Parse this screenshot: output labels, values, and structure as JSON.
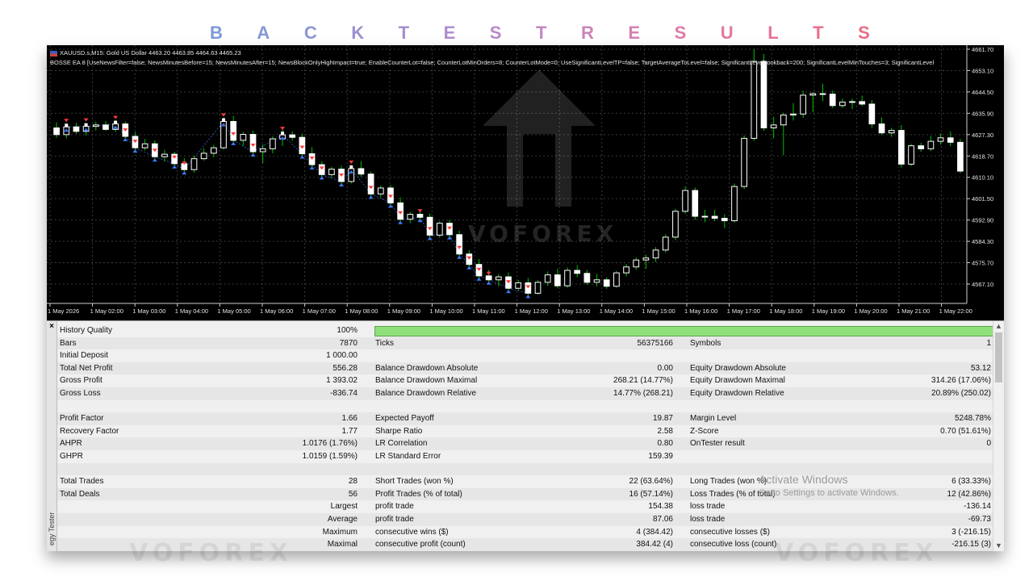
{
  "page_title": {
    "letters": [
      {
        "ch": "B",
        "color": "#7b9ad8"
      },
      {
        "ch": "A",
        "color": "#8597d6"
      },
      {
        "ch": "C",
        "color": "#8f95d4"
      },
      {
        "ch": "K",
        "color": "#9a92d2"
      },
      {
        "ch": "T",
        "color": "#a590cf"
      },
      {
        "ch": "E",
        "color": "#b08ecc"
      },
      {
        "ch": "S",
        "color": "#ba8ac8"
      },
      {
        "ch": "T",
        "color": "#c487c2"
      },
      {
        "ch": "R",
        "color": "#cc84ba"
      },
      {
        "ch": "E",
        "color": "#d680b2"
      },
      {
        "ch": "S",
        "color": "#dd7ca9"
      },
      {
        "ch": "U",
        "color": "#e278a0"
      },
      {
        "ch": "L",
        "color": "#e57496"
      },
      {
        "ch": "T",
        "color": "#e8718d"
      },
      {
        "ch": "S",
        "color": "#ea6d85"
      }
    ]
  },
  "chart": {
    "symbol_line": "XAUUSD.s,M15:  Gold US Dollar  4463.20 4463.85 4464.63 4465.23",
    "ea_line": "BOSSE EA 8 [UseNewsFilter=false; NewsMinutesBefore=15; NewsMinutesAfter=15; NewsBlockOnlyHighImpact=true; EnableCounterLot=false; CounterLotMinOrders=8; CounterLotMode=0; UseSignificantLevelTP=false; TargetAverageToLevel=false; SignificantLevelLookback=200; SignificantLevelMinTouches=3; SignificantLevel",
    "watermark": "VOFOREX",
    "price_labels": [
      "4661.70",
      "4653.10",
      "4644.50",
      "4635.90",
      "4627.30",
      "4618.70",
      "4610.10",
      "4601.50",
      "4592.90",
      "4584.30",
      "4575.70",
      "4567.10"
    ],
    "time_labels": [
      "1 May 2026",
      "1 May 02:00",
      "1 May 03:00",
      "1 May 04:00",
      "1 May 05:00",
      "1 May 06:00",
      "1 May 07:00",
      "1 May 08:00",
      "1 May 09:00",
      "1 May 10:00",
      "1 May 11:00",
      "1 May 12:00",
      "1 May 13:00",
      "1 May 14:00",
      "1 May 15:00",
      "1 May 16:00",
      "1 May 17:00",
      "1 May 18:00",
      "1 May 19:00",
      "1 May 20:00",
      "1 May 21:00",
      "1 May 22:00"
    ],
    "colors": {
      "background": "#000000",
      "bull": "#ffffff",
      "bear": "#ffffff",
      "wick": "#00c000",
      "grid": "#3a3a3a",
      "buy_marker": "#3a7bff",
      "sell_marker": "#ff3b3b",
      "order_line": "#3a6fd8"
    },
    "candles": [
      {
        "o": 4630.0,
        "h": 4632.2,
        "l": 4626.0,
        "c": 4627.3
      },
      {
        "o": 4627.3,
        "h": 4631.2,
        "l": 4625.8,
        "c": 4630.4
      },
      {
        "o": 4630.4,
        "h": 4632.0,
        "l": 4627.6,
        "c": 4628.6
      },
      {
        "o": 4628.6,
        "h": 4631.8,
        "l": 4627.0,
        "c": 4630.6
      },
      {
        "o": 4630.6,
        "h": 4632.5,
        "l": 4628.9,
        "c": 4631.2
      },
      {
        "o": 4631.2,
        "h": 4632.8,
        "l": 4628.8,
        "c": 4629.4
      },
      {
        "o": 4629.4,
        "h": 4633.0,
        "l": 4628.4,
        "c": 4631.6
      },
      {
        "o": 4631.6,
        "h": 4632.6,
        "l": 4625.8,
        "c": 4626.6
      },
      {
        "o": 4626.6,
        "h": 4628.4,
        "l": 4620.8,
        "c": 4622.0
      },
      {
        "o": 4622.0,
        "h": 4625.6,
        "l": 4620.9,
        "c": 4623.6
      },
      {
        "o": 4623.6,
        "h": 4625.0,
        "l": 4617.6,
        "c": 4618.4
      },
      {
        "o": 4618.4,
        "h": 4621.2,
        "l": 4616.4,
        "c": 4619.4
      },
      {
        "o": 4619.4,
        "h": 4620.4,
        "l": 4614.8,
        "c": 4615.6
      },
      {
        "o": 4615.6,
        "h": 4617.8,
        "l": 4612.2,
        "c": 4613.2
      },
      {
        "o": 4613.2,
        "h": 4618.8,
        "l": 4612.0,
        "c": 4617.6
      },
      {
        "o": 4617.6,
        "h": 4621.8,
        "l": 4616.8,
        "c": 4619.8
      },
      {
        "o": 4619.8,
        "h": 4623.2,
        "l": 4618.2,
        "c": 4622.0
      },
      {
        "o": 4622.0,
        "h": 4634.0,
        "l": 4621.2,
        "c": 4632.6
      },
      {
        "o": 4632.6,
        "h": 4634.8,
        "l": 4624.0,
        "c": 4625.0
      },
      {
        "o": 4625.0,
        "h": 4628.4,
        "l": 4622.8,
        "c": 4627.4
      },
      {
        "o": 4627.4,
        "h": 4628.9,
        "l": 4619.4,
        "c": 4620.4
      },
      {
        "o": 4620.4,
        "h": 4623.4,
        "l": 4615.8,
        "c": 4621.6
      },
      {
        "o": 4621.6,
        "h": 4626.6,
        "l": 4619.8,
        "c": 4625.6
      },
      {
        "o": 4625.6,
        "h": 4629.6,
        "l": 4622.8,
        "c": 4627.2
      },
      {
        "o": 4627.2,
        "h": 4628.6,
        "l": 4624.8,
        "c": 4626.2
      },
      {
        "o": 4626.2,
        "h": 4627.6,
        "l": 4618.8,
        "c": 4619.6
      },
      {
        "o": 4619.6,
        "h": 4622.2,
        "l": 4613.8,
        "c": 4615.2
      },
      {
        "o": 4615.2,
        "h": 4616.6,
        "l": 4609.8,
        "c": 4611.2
      },
      {
        "o": 4611.2,
        "h": 4614.4,
        "l": 4610.1,
        "c": 4613.4
      },
      {
        "o": 4613.4,
        "h": 4614.8,
        "l": 4607.6,
        "c": 4608.4
      },
      {
        "o": 4608.4,
        "h": 4614.8,
        "l": 4607.6,
        "c": 4613.6
      },
      {
        "o": 4613.6,
        "h": 4616.6,
        "l": 4610.2,
        "c": 4611.4
      },
      {
        "o": 4611.4,
        "h": 4612.4,
        "l": 4602.0,
        "c": 4603.4
      },
      {
        "o": 4603.4,
        "h": 4606.8,
        "l": 4602.0,
        "c": 4605.8
      },
      {
        "o": 4605.8,
        "h": 4607.0,
        "l": 4598.6,
        "c": 4599.8
      },
      {
        "o": 4599.8,
        "h": 4602.0,
        "l": 4592.0,
        "c": 4593.2
      },
      {
        "o": 4593.2,
        "h": 4596.2,
        "l": 4591.6,
        "c": 4595.2
      },
      {
        "o": 4595.2,
        "h": 4596.8,
        "l": 4592.8,
        "c": 4594.0
      },
      {
        "o": 4594.0,
        "h": 4595.4,
        "l": 4585.6,
        "c": 4586.8
      },
      {
        "o": 4586.8,
        "h": 4592.4,
        "l": 4585.8,
        "c": 4591.6
      },
      {
        "o": 4591.6,
        "h": 4593.0,
        "l": 4586.0,
        "c": 4587.0
      },
      {
        "o": 4587.0,
        "h": 4588.6,
        "l": 4578.0,
        "c": 4579.2
      },
      {
        "o": 4579.2,
        "h": 4580.8,
        "l": 4573.8,
        "c": 4575.0
      },
      {
        "o": 4575.0,
        "h": 4577.2,
        "l": 4569.4,
        "c": 4570.4
      },
      {
        "o": 4570.4,
        "h": 4572.8,
        "l": 4568.0,
        "c": 4568.8
      },
      {
        "o": 4568.8,
        "h": 4571.2,
        "l": 4566.2,
        "c": 4570.0
      },
      {
        "o": 4570.0,
        "h": 4571.8,
        "l": 4564.4,
        "c": 4565.4
      },
      {
        "o": 4565.4,
        "h": 4568.8,
        "l": 4564.4,
        "c": 4567.6
      },
      {
        "o": 4567.6,
        "h": 4569.6,
        "l": 4562.4,
        "c": 4563.4
      },
      {
        "o": 4563.4,
        "h": 4568.6,
        "l": 4562.8,
        "c": 4567.8
      },
      {
        "o": 4567.8,
        "h": 4572.2,
        "l": 4566.4,
        "c": 4570.8
      },
      {
        "o": 4570.8,
        "h": 4573.2,
        "l": 4565.4,
        "c": 4566.4
      },
      {
        "o": 4566.4,
        "h": 4573.8,
        "l": 4565.6,
        "c": 4572.6
      },
      {
        "o": 4572.6,
        "h": 4574.8,
        "l": 4569.8,
        "c": 4571.4
      },
      {
        "o": 4571.4,
        "h": 4572.8,
        "l": 4566.8,
        "c": 4567.8
      },
      {
        "o": 4567.8,
        "h": 4571.2,
        "l": 4566.2,
        "c": 4568.8
      },
      {
        "o": 4568.8,
        "h": 4569.8,
        "l": 4565.2,
        "c": 4566.2
      },
      {
        "o": 4566.2,
        "h": 4572.4,
        "l": 4565.6,
        "c": 4571.6
      },
      {
        "o": 4571.6,
        "h": 4575.2,
        "l": 4570.2,
        "c": 4574.0
      },
      {
        "o": 4574.0,
        "h": 4577.8,
        "l": 4572.8,
        "c": 4576.8
      },
      {
        "o": 4576.8,
        "h": 4579.0,
        "l": 4573.2,
        "c": 4577.6
      },
      {
        "o": 4577.6,
        "h": 4582.0,
        "l": 4576.0,
        "c": 4580.8
      },
      {
        "o": 4580.8,
        "h": 4587.2,
        "l": 4579.8,
        "c": 4586.0
      },
      {
        "o": 4586.0,
        "h": 4597.4,
        "l": 4584.8,
        "c": 4596.4
      },
      {
        "o": 4596.4,
        "h": 4606.4,
        "l": 4595.4,
        "c": 4604.8
      },
      {
        "o": 4604.8,
        "h": 4606.0,
        "l": 4593.0,
        "c": 4594.4
      },
      {
        "o": 4594.4,
        "h": 4597.0,
        "l": 4592.0,
        "c": 4594.4
      },
      {
        "o": 4594.4,
        "h": 4597.0,
        "l": 4592.4,
        "c": 4593.6
      },
      {
        "o": 4593.6,
        "h": 4595.2,
        "l": 4589.6,
        "c": 4592.6
      },
      {
        "o": 4592.6,
        "h": 4607.6,
        "l": 4591.8,
        "c": 4606.4
      },
      {
        "o": 4606.4,
        "h": 4627.0,
        "l": 4605.4,
        "c": 4625.8
      },
      {
        "o": 4625.8,
        "h": 4661.8,
        "l": 4624.8,
        "c": 4656.8
      },
      {
        "o": 4656.8,
        "h": 4659.8,
        "l": 4628.8,
        "c": 4630.0
      },
      {
        "o": 4630.0,
        "h": 4634.4,
        "l": 4625.8,
        "c": 4631.2
      },
      {
        "o": 4631.2,
        "h": 4636.2,
        "l": 4619.0,
        "c": 4635.2
      },
      {
        "o": 4635.2,
        "h": 4640.0,
        "l": 4633.0,
        "c": 4635.6
      },
      {
        "o": 4635.6,
        "h": 4645.0,
        "l": 4634.0,
        "c": 4643.2
      },
      {
        "o": 4643.2,
        "h": 4644.4,
        "l": 4636.2,
        "c": 4643.8
      },
      {
        "o": 4643.8,
        "h": 4647.8,
        "l": 4640.8,
        "c": 4643.6
      },
      {
        "o": 4643.6,
        "h": 4645.0,
        "l": 4638.0,
        "c": 4639.0
      },
      {
        "o": 4639.0,
        "h": 4641.8,
        "l": 4638.0,
        "c": 4640.4
      },
      {
        "o": 4640.4,
        "h": 4641.8,
        "l": 4637.6,
        "c": 4640.6
      },
      {
        "o": 4640.6,
        "h": 4643.0,
        "l": 4638.8,
        "c": 4639.6
      },
      {
        "o": 4639.6,
        "h": 4641.2,
        "l": 4630.0,
        "c": 4631.6
      },
      {
        "o": 4631.6,
        "h": 4634.2,
        "l": 4627.2,
        "c": 4628.0
      },
      {
        "o": 4628.0,
        "h": 4630.0,
        "l": 4626.4,
        "c": 4629.0
      },
      {
        "o": 4629.0,
        "h": 4631.2,
        "l": 4614.0,
        "c": 4615.4
      },
      {
        "o": 4615.4,
        "h": 4623.6,
        "l": 4614.6,
        "c": 4622.8
      },
      {
        "o": 4622.8,
        "h": 4624.0,
        "l": 4620.4,
        "c": 4621.6
      },
      {
        "o": 4621.6,
        "h": 4626.8,
        "l": 4620.6,
        "c": 4624.6
      },
      {
        "o": 4624.6,
        "h": 4627.8,
        "l": 4623.2,
        "c": 4626.0
      },
      {
        "o": 4626.0,
        "h": 4628.6,
        "l": 4622.6,
        "c": 4624.2
      },
      {
        "o": 4624.2,
        "h": 4625.6,
        "l": 4611.8,
        "c": 4612.6
      }
    ],
    "trade_markers": [
      {
        "i": 1,
        "p": 4630.4
      },
      {
        "i": 3,
        "p": 4630.6
      },
      {
        "i": 6,
        "p": 4631.6
      },
      {
        "i": 7,
        "p": 4626.6
      },
      {
        "i": 8,
        "p": 4622.0
      },
      {
        "i": 10,
        "p": 4618.4
      },
      {
        "i": 12,
        "p": 4615.6
      },
      {
        "i": 13,
        "p": 4613.2
      },
      {
        "i": 17,
        "p": 4632.6
      },
      {
        "i": 18,
        "p": 4625.0
      },
      {
        "i": 20,
        "p": 4620.4
      },
      {
        "i": 23,
        "p": 4627.2
      },
      {
        "i": 25,
        "p": 4619.6
      },
      {
        "i": 26,
        "p": 4615.2
      },
      {
        "i": 27,
        "p": 4611.2
      },
      {
        "i": 29,
        "p": 4608.4
      },
      {
        "i": 30,
        "p": 4613.6
      },
      {
        "i": 32,
        "p": 4603.4
      },
      {
        "i": 34,
        "p": 4599.8
      },
      {
        "i": 35,
        "p": 4593.2
      },
      {
        "i": 37,
        "p": 4594.0
      },
      {
        "i": 38,
        "p": 4586.8
      },
      {
        "i": 40,
        "p": 4587.0
      },
      {
        "i": 41,
        "p": 4579.2
      },
      {
        "i": 42,
        "p": 4575.0
      },
      {
        "i": 43,
        "p": 4570.4
      },
      {
        "i": 44,
        "p": 4568.8
      },
      {
        "i": 46,
        "p": 4565.4
      },
      {
        "i": 48,
        "p": 4563.4
      }
    ]
  },
  "report": {
    "history_quality": {
      "label": "History Quality",
      "value": "100%",
      "fill_fraction": 1.0
    },
    "rows": [
      {
        "alt": true,
        "c1": "Bars",
        "c2": "7870",
        "c3": "Ticks",
        "c4": "56375166",
        "c5": "Symbols",
        "c6": "1"
      },
      {
        "alt": false,
        "c1": "Initial Deposit",
        "c2": "1 000.00",
        "c3": "",
        "c4": "",
        "c5": "",
        "c6": ""
      },
      {
        "alt": true,
        "c1": "Total Net Profit",
        "c2": "556.28",
        "c3": "Balance Drawdown Absolute",
        "c4": "0.00",
        "c5": "Equity Drawdown Absolute",
        "c6": "53.12"
      },
      {
        "alt": false,
        "c1": "Gross Profit",
        "c2": "1 393.02",
        "c3": "Balance Drawdown Maximal",
        "c4": "268.21 (14.77%)",
        "c5": "Equity Drawdown Maximal",
        "c6": "314.26 (17.06%)"
      },
      {
        "alt": true,
        "c1": "Gross Loss",
        "c2": "-836.74",
        "c3": "Balance Drawdown Relative",
        "c4": "14.77% (268.21)",
        "c5": "Equity Drawdown Relative",
        "c6": "20.89% (250.02)"
      },
      {
        "alt": false,
        "c1": "",
        "c2": "",
        "c3": "",
        "c4": "",
        "c5": "",
        "c6": ""
      },
      {
        "alt": true,
        "c1": "Profit Factor",
        "c2": "1.66",
        "c3": "Expected Payoff",
        "c4": "19.87",
        "c5": "Margin Level",
        "c6": "5248.78%"
      },
      {
        "alt": false,
        "c1": "Recovery Factor",
        "c2": "1.77",
        "c3": "Sharpe Ratio",
        "c4": "2.58",
        "c5": "Z-Score",
        "c6": "0.70 (51.61%)"
      },
      {
        "alt": true,
        "c1": "AHPR",
        "c2": "1.0176 (1.76%)",
        "c3": "LR Correlation",
        "c4": "0.80",
        "c5": "OnTester result",
        "c6": "0"
      },
      {
        "alt": false,
        "c1": "GHPR",
        "c2": "1.0159 (1.59%)",
        "c3": "LR Standard Error",
        "c4": "159.39",
        "c5": "",
        "c6": ""
      },
      {
        "alt": true,
        "c1": "",
        "c2": "",
        "c3": "",
        "c4": "",
        "c5": "",
        "c6": ""
      },
      {
        "alt": false,
        "c1": "Total Trades",
        "c2": "28",
        "c3": "Short Trades (won %)",
        "c4": "22 (63.64%)",
        "c5": "Long Trades (won %)",
        "c6": "6 (33.33%)"
      },
      {
        "alt": true,
        "c1": "Total Deals",
        "c2": "56",
        "c3": "Profit Trades (% of total)",
        "c4": "16 (57.14%)",
        "c5": "Loss Trades (% of total)",
        "c6": "12 (42.86%)"
      },
      {
        "alt": false,
        "c1": "",
        "c2": "Largest",
        "c3": "profit trade",
        "c4": "154.38",
        "c5": "loss trade",
        "c6": "-136.14"
      },
      {
        "alt": true,
        "c1": "",
        "c2": "Average",
        "c3": "profit trade",
        "c4": "87.06",
        "c5": "loss trade",
        "c6": "-69.73"
      },
      {
        "alt": false,
        "c1": "",
        "c2": "Maximum",
        "c3": "consecutive wins ($)",
        "c4": "4 (384.42)",
        "c5": "consecutive losses ($)",
        "c6": "3 (-216.15)"
      },
      {
        "alt": true,
        "c1": "",
        "c2": "Maximal",
        "c3": "consecutive profit (count)",
        "c4": "384.42 (4)",
        "c5": "consecutive loss (count)",
        "c6": "-216.15 (3)"
      }
    ]
  },
  "side_panel": {
    "close": "×",
    "vertical_label": "egy Tester"
  },
  "activate_windows": {
    "line1": "Activate Windows",
    "line2": "Go to Settings to activate Windows."
  },
  "watermarks": {
    "bottom": "VOFOREX"
  }
}
